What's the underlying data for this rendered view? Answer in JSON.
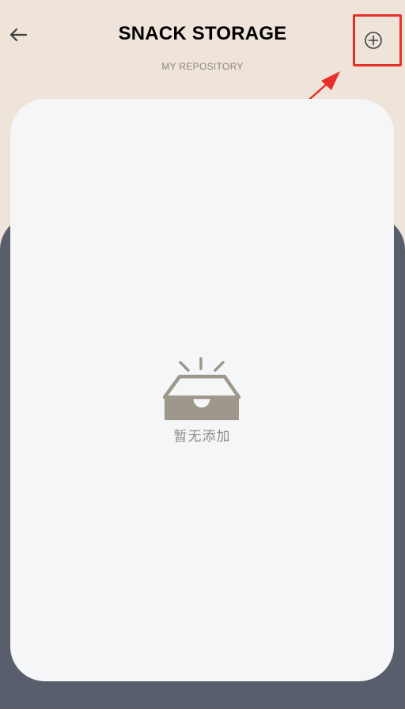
{
  "header": {
    "title": "SNACK STORAGE",
    "subtitle": "MY REPOSITORY",
    "back_icon": "arrow-left-icon",
    "add_icon": "plus-circle-icon"
  },
  "empty_state": {
    "icon": "empty-inbox-icon",
    "message": "暂无添加"
  },
  "colors": {
    "background": "#efe4da",
    "dark_panel": "#585e6b",
    "card": "#f5f6f8",
    "icon": "#9e978b",
    "annotation": "#e8302a"
  }
}
